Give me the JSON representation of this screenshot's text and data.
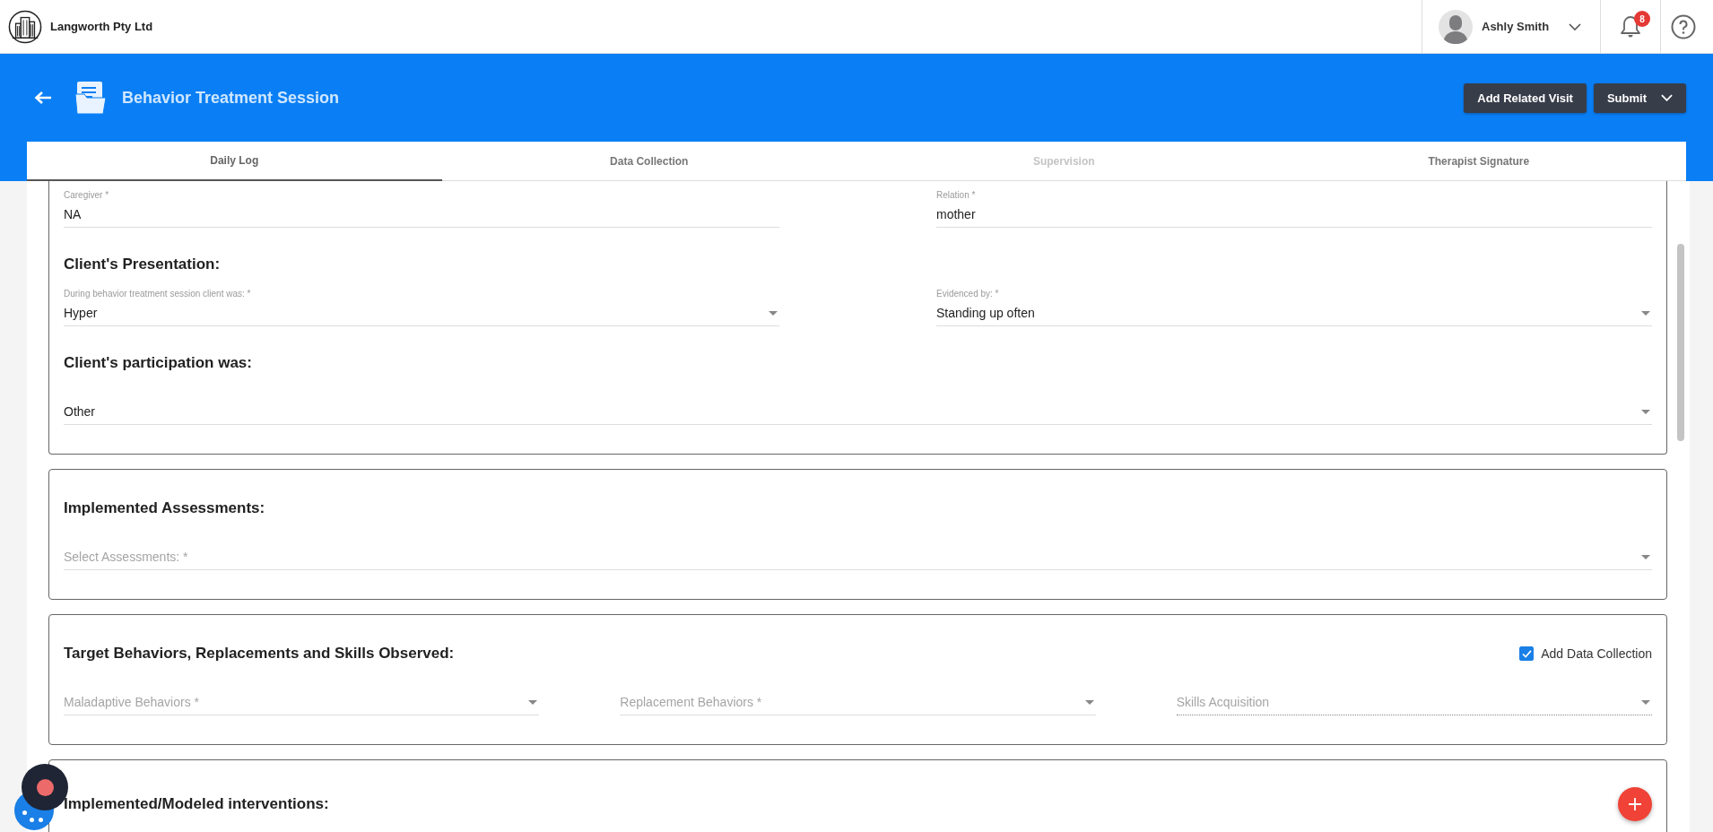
{
  "top_bar": {
    "company": "Langworth Pty Ltd",
    "user": {
      "name": "Ashly Smith"
    },
    "notifications": {
      "count": "8"
    }
  },
  "header": {
    "title": "Behavior Treatment Session",
    "buttons": [
      {
        "label": "Add Related Visit",
        "kind": "plain"
      },
      {
        "label": "Submit",
        "kind": "dropdown"
      }
    ]
  },
  "tabs": [
    {
      "label": "Daily Log",
      "selected": true,
      "disabled": false
    },
    {
      "label": "Data Collection",
      "selected": false,
      "disabled": false
    },
    {
      "label": "Supervision",
      "selected": false,
      "disabled": true
    },
    {
      "label": "Therapist Signature",
      "selected": false,
      "disabled": false
    }
  ],
  "sections": [
    {
      "blocks": [
        {
          "kind": "fields",
          "fields": [
            {
              "kind": "text",
              "label": "Caregiver *",
              "value": "NA",
              "disabled": false
            },
            {
              "kind": "text",
              "label": "Relation *",
              "value": "mother",
              "disabled": false
            }
          ]
        },
        {
          "kind": "heading",
          "text": "Client's Presentation:"
        },
        {
          "kind": "fields",
          "fields": [
            {
              "kind": "select",
              "label": "During behavior treatment session client was: *",
              "value": "Hyper",
              "disabled": false
            },
            {
              "kind": "select",
              "label": "Evidenced by: *",
              "value": "Standing up often",
              "disabled": false
            }
          ]
        },
        {
          "kind": "heading",
          "text": "Client's participation was:"
        },
        {
          "kind": "fields",
          "fields": [
            {
              "kind": "select",
              "value": "Other",
              "disabled": false
            }
          ]
        }
      ]
    },
    {
      "blocks": [
        {
          "kind": "heading",
          "text": "Implemented Assessments:"
        },
        {
          "kind": "fields",
          "fields": [
            {
              "kind": "select",
              "placeholder": "Select Assessments: *",
              "disabled": false
            }
          ]
        }
      ]
    },
    {
      "blocks": [
        {
          "kind": "heading",
          "text": "Target Behaviors, Replacements and Skills Observed:",
          "checkbox": {
            "label": "Add Data Collection",
            "checked": true
          }
        },
        {
          "kind": "fields",
          "fields": [
            {
              "kind": "select",
              "placeholder": "Maladaptive Behaviors *",
              "disabled": false
            },
            {
              "kind": "select",
              "placeholder": "Replacement Behaviors *",
              "disabled": false
            },
            {
              "kind": "select",
              "placeholder": "Skills Acquisition",
              "disabled": true
            }
          ]
        }
      ]
    },
    {
      "blocks": [
        {
          "kind": "heading",
          "text": "Implemented/Modeled interventions:",
          "add_button": true
        }
      ]
    }
  ]
}
